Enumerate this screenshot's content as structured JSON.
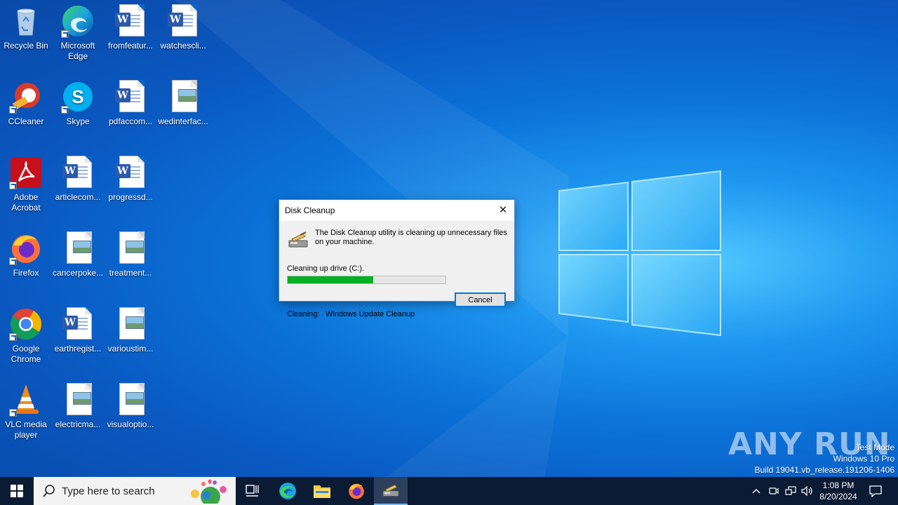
{
  "desktop": {
    "icons": [
      {
        "label": "Recycle Bin"
      },
      {
        "label": "Microsoft Edge"
      },
      {
        "label": "fromfeatur..."
      },
      {
        "label": "watchescli..."
      },
      {
        "label": "CCleaner"
      },
      {
        "label": "Skype"
      },
      {
        "label": "pdfaccom..."
      },
      {
        "label": "wedinterfac..."
      },
      {
        "label": "Adobe Acrobat"
      },
      {
        "label": "articlecom..."
      },
      {
        "label": "progressd..."
      },
      {
        "label": "Firefox"
      },
      {
        "label": "cancerpoke..."
      },
      {
        "label": "treatment..."
      },
      {
        "label": "Google Chrome"
      },
      {
        "label": "earthregist..."
      },
      {
        "label": "varioustim..."
      },
      {
        "label": "VLC media player"
      },
      {
        "label": "electricma..."
      },
      {
        "label": "visualoptio..."
      }
    ]
  },
  "dialog": {
    "title": "Disk Cleanup",
    "message": "The Disk Cleanup utility is cleaning up unnecessary files on your machine.",
    "drive_label": "Cleaning up drive  (C:).",
    "progress_fraction": 0.54,
    "cancel_label": "Cancel",
    "cleaning_label": "Cleaning:",
    "cleaning_value": "Windows Update Cleanup"
  },
  "watermark": {
    "anyrun": "ANY RUN",
    "line1": "Test Mode",
    "line2": "Windows 10 Pro",
    "line3": "Build 19041.vb_release.191206-1406"
  },
  "taskbar": {
    "search_placeholder": "Type here to search",
    "time": "1:08 PM",
    "date": "8/20/2024"
  },
  "colors": {
    "progress": "#06b025",
    "accent": "#0078d7",
    "taskbar": "#0b1b33"
  }
}
